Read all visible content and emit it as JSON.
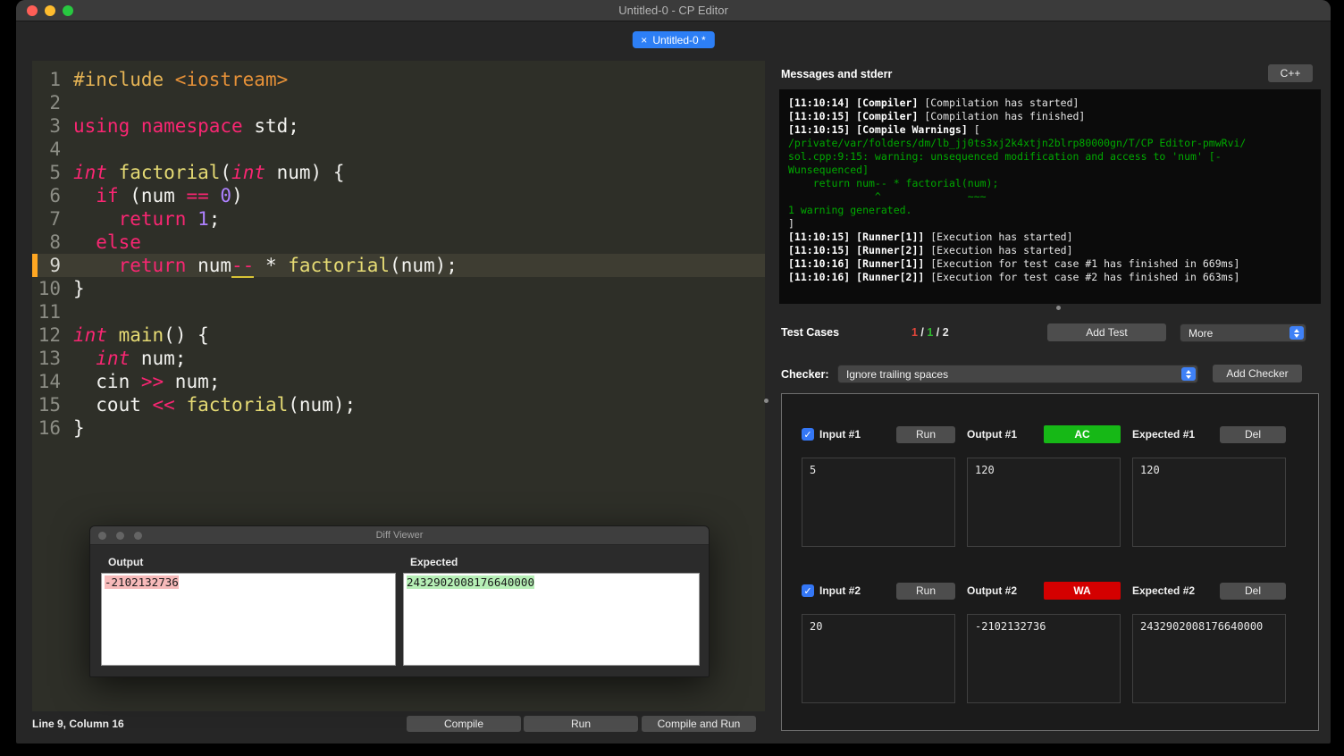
{
  "window": {
    "title": "Untitled-0 - CP Editor"
  },
  "tab": {
    "close_icon": "×",
    "label": "Untitled-0 *"
  },
  "editor": {
    "current_line": 9,
    "lines": [
      {
        "n": "1",
        "seg": [
          [
            "pre",
            "#include "
          ],
          [
            "hdr",
            "<iostream>"
          ]
        ]
      },
      {
        "n": "2",
        "seg": []
      },
      {
        "n": "3",
        "seg": [
          [
            "kw",
            "using"
          ],
          [
            "pl",
            " "
          ],
          [
            "kw",
            "namespace"
          ],
          [
            "pl",
            " std;"
          ]
        ]
      },
      {
        "n": "4",
        "seg": []
      },
      {
        "n": "5",
        "seg": [
          [
            "type",
            "int"
          ],
          [
            "pl",
            " "
          ],
          [
            "fn",
            "factorial"
          ],
          [
            "pl",
            "("
          ],
          [
            "type",
            "int"
          ],
          [
            "pl",
            " num) {"
          ]
        ]
      },
      {
        "n": "6",
        "seg": [
          [
            "pl",
            "  "
          ],
          [
            "kw",
            "if"
          ],
          [
            "pl",
            " (num "
          ],
          [
            "op",
            "=="
          ],
          [
            "pl",
            " "
          ],
          [
            "num",
            "0"
          ],
          [
            "pl",
            ")"
          ]
        ]
      },
      {
        "n": "7",
        "seg": [
          [
            "pl",
            "    "
          ],
          [
            "kw",
            "return"
          ],
          [
            "pl",
            " "
          ],
          [
            "num",
            "1"
          ],
          [
            "pl",
            ";"
          ]
        ]
      },
      {
        "n": "8",
        "seg": [
          [
            "pl",
            "  "
          ],
          [
            "kw",
            "else"
          ]
        ]
      },
      {
        "n": "9",
        "seg": [
          [
            "pl",
            "    "
          ],
          [
            "kw",
            "return"
          ],
          [
            "pl",
            " num"
          ],
          [
            "opu",
            "--"
          ],
          [
            "pl",
            " * "
          ],
          [
            "fn",
            "factorial"
          ],
          [
            "pl",
            "(num);"
          ]
        ]
      },
      {
        "n": "10",
        "seg": [
          [
            "pl",
            "}"
          ]
        ]
      },
      {
        "n": "11",
        "seg": []
      },
      {
        "n": "12",
        "seg": [
          [
            "type",
            "int"
          ],
          [
            "pl",
            " "
          ],
          [
            "fn",
            "main"
          ],
          [
            "pl",
            "() {"
          ]
        ]
      },
      {
        "n": "13",
        "seg": [
          [
            "pl",
            "  "
          ],
          [
            "type",
            "int"
          ],
          [
            "pl",
            " num;"
          ]
        ]
      },
      {
        "n": "14",
        "seg": [
          [
            "pl",
            "  cin "
          ],
          [
            "op",
            ">>"
          ],
          [
            "pl",
            " num;"
          ]
        ]
      },
      {
        "n": "15",
        "seg": [
          [
            "pl",
            "  cout "
          ],
          [
            "op",
            "<<"
          ],
          [
            "pl",
            " "
          ],
          [
            "fn",
            "factorial"
          ],
          [
            "pl",
            "(num);"
          ]
        ]
      },
      {
        "n": "16",
        "seg": [
          [
            "pl",
            "}"
          ]
        ]
      }
    ],
    "status": "Line 9, Column 16",
    "buttons": {
      "compile": "Compile",
      "run": "Run",
      "compile_and_run": "Compile and Run"
    }
  },
  "messages": {
    "title": "Messages and stderr",
    "lang_button": "C++",
    "console": [
      [
        [
          "b",
          "[11:10:14] [Compiler] "
        ],
        [
          "w",
          "[Compilation has started]"
        ]
      ],
      [
        [
          "b",
          "[11:10:15] [Compiler] "
        ],
        [
          "w",
          "[Compilation has finished]"
        ]
      ],
      [
        [
          "b",
          "[11:10:15] [Compile Warnings] "
        ],
        [
          "w",
          "["
        ]
      ],
      [
        [
          "g",
          "/private/var/folders/dm/lb_jj0ts3xj2k4xtjn2blrp80000gn/T/CP Editor-pmwRvi/"
        ]
      ],
      [
        [
          "g",
          "sol.cpp:9:15: warning: unsequenced modification and access to 'num' [-"
        ]
      ],
      [
        [
          "g",
          "Wunsequenced]"
        ]
      ],
      [
        [
          "g",
          "    return num-- * factorial(num);"
        ]
      ],
      [
        [
          "g",
          "              ^              ~~~"
        ]
      ],
      [
        [
          "g",
          "1 warning generated."
        ]
      ],
      [
        [
          "w",
          "]"
        ]
      ],
      [
        [
          "b",
          "[11:10:15] [Runner[1]] "
        ],
        [
          "w",
          "[Execution has started]"
        ]
      ],
      [
        [
          "b",
          "[11:10:15] [Runner[2]] "
        ],
        [
          "w",
          "[Execution has started]"
        ]
      ],
      [
        [
          "b",
          "[11:10:16] [Runner[1]] "
        ],
        [
          "w",
          "[Execution for test case #1 has finished in 669ms]"
        ]
      ],
      [
        [
          "b",
          "[11:10:16] [Runner[2]] "
        ],
        [
          "w",
          "[Execution for test case #2 has finished in 663ms]"
        ]
      ]
    ]
  },
  "tests": {
    "header": "Test Cases",
    "summary": [
      [
        "red",
        "1"
      ],
      [
        "w",
        " / "
      ],
      [
        "green",
        "1"
      ],
      [
        "w",
        " / 2"
      ]
    ],
    "add_test": "Add Test",
    "more": "More",
    "checker_label": "Checker:",
    "checker_value": "Ignore trailing spaces",
    "add_checker": "Add Checker",
    "verdict_colors": {
      "ac": "#16b816",
      "wa": "#d40000"
    },
    "cases": [
      {
        "input_label": "Input #1",
        "run": "Run",
        "output_label": "Output #1",
        "verdict": "AC",
        "verdict_color": "#16b816",
        "expected_label": "Expected #1",
        "del": "Del",
        "input": "5",
        "output": "120",
        "expected": "120",
        "check_icon": "✓"
      },
      {
        "input_label": "Input #2",
        "run": "Run",
        "output_label": "Output #2",
        "verdict": "WA",
        "verdict_color": "#d40000",
        "expected_label": "Expected #2",
        "del": "Del",
        "input": "20",
        "output": "-2102132736",
        "expected": "2432902008176640000",
        "check_icon": "✓"
      }
    ]
  },
  "diff": {
    "title": "Diff Viewer",
    "output_label": "Output",
    "expected_label": "Expected",
    "output_value": "-2102132736",
    "expected_value": "2432902008176640000"
  }
}
